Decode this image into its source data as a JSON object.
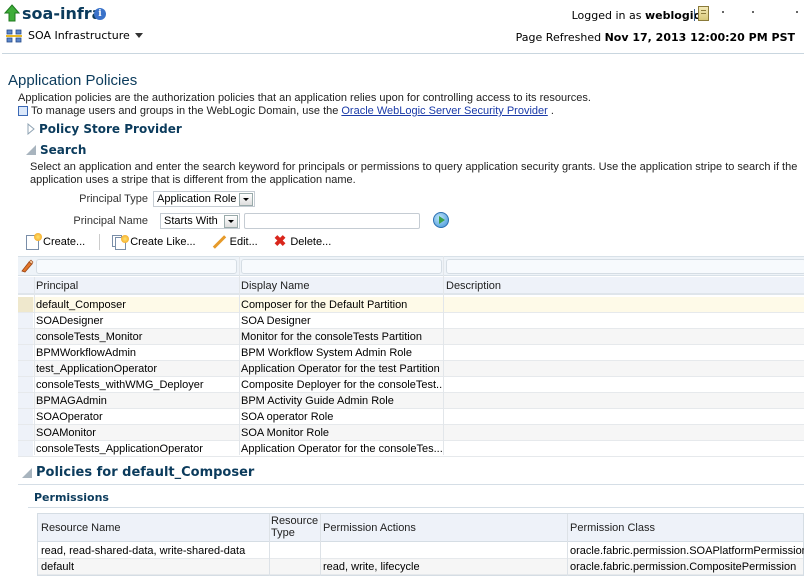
{
  "header": {
    "app_title": "soa-infra",
    "target_menu_label": "SOA Infrastructure",
    "logged_in_prefix": "Logged in as",
    "logged_in_user": "weblogic",
    "refreshed_prefix": "Page Refreshed",
    "refreshed_time": "Nov 17, 2013 12:00:20 PM PST"
  },
  "page": {
    "title": "Application Policies",
    "description": "Application policies are the authorization policies that an application relies upon for controlling access to its resources.",
    "manage_text": "To manage users and groups in the WebLogic Domain, use the",
    "manage_link": "Oracle WebLogic Server Security Provider",
    "manage_suffix": "."
  },
  "sections": {
    "policy_store": "Policy Store Provider",
    "search": "Search",
    "search_description": "Select an application and enter the search keyword for principals or permissions to query application security grants. Use the application stripe to search if the application uses a stripe that is different from the application name."
  },
  "search_form": {
    "principal_type_label": "Principal Type",
    "principal_type_value": "Application Role",
    "principal_name_label": "Principal Name",
    "principal_name_operator": "Starts With",
    "principal_name_value": ""
  },
  "toolbar": {
    "create": "Create...",
    "create_like": "Create Like...",
    "edit": "Edit...",
    "delete": "Delete..."
  },
  "principals_table": {
    "columns": [
      "Principal",
      "Display Name",
      "Description"
    ],
    "rows": [
      {
        "principal": "default_Composer",
        "display_name": "Composer for the Default Partition",
        "description": "",
        "selected": true
      },
      {
        "principal": "SOADesigner",
        "display_name": "SOA Designer",
        "description": ""
      },
      {
        "principal": "consoleTests_Monitor",
        "display_name": "Monitor for the consoleTests Partition",
        "description": ""
      },
      {
        "principal": "BPMWorkflowAdmin",
        "display_name": "BPM Workflow System Admin Role",
        "description": ""
      },
      {
        "principal": "test_ApplicationOperator",
        "display_name": "Application Operator for the test Partition",
        "description": ""
      },
      {
        "principal": "consoleTests_withWMG_Deployer",
        "display_name": "Composite Deployer for the consoleTest...",
        "description": ""
      },
      {
        "principal": "BPMAGAdmin",
        "display_name": "BPM Activity Guide Admin Role",
        "description": ""
      },
      {
        "principal": "SOAOperator",
        "display_name": "SOA operator Role",
        "description": ""
      },
      {
        "principal": "SOAMonitor",
        "display_name": "SOA Monitor Role",
        "description": ""
      },
      {
        "principal": "consoleTests_ApplicationOperator",
        "display_name": "Application Operator for the consoleTes...",
        "description": ""
      }
    ]
  },
  "policies": {
    "title": "Policies for default_Composer",
    "permissions_label": "Permissions",
    "columns": [
      "Resource Name",
      "Resource Type",
      "Permission Actions",
      "Permission Class"
    ],
    "rows": [
      {
        "resource_name": "read, read-shared-data, write-shared-data",
        "resource_type": "",
        "actions": "",
        "class": "oracle.fabric.permission.SOAPlatformPermission"
      },
      {
        "resource_name": "default",
        "resource_type": "",
        "actions": "read, write, lifecycle",
        "class": "oracle.fabric.permission.CompositePermission"
      }
    ]
  }
}
